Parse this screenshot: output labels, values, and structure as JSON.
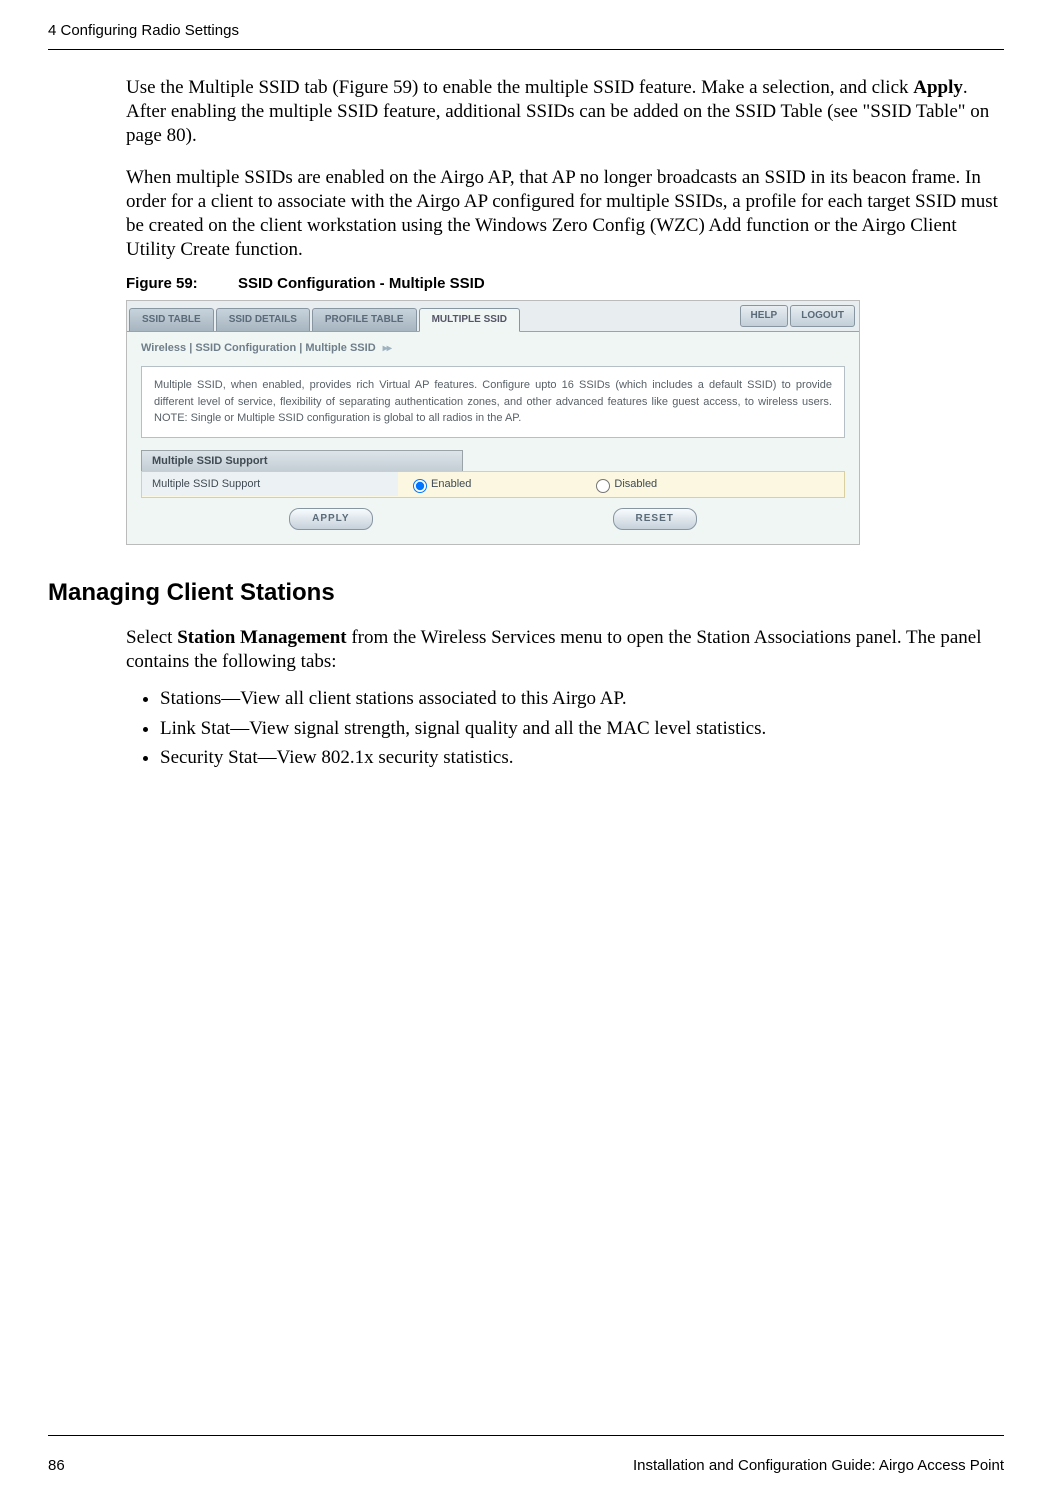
{
  "header": {
    "chapter": "4  Configuring Radio Settings"
  },
  "paragraphs": {
    "p1_a": "Use the Multiple SSID tab (Figure 59) to enable the multiple SSID feature. Make a selection, and click ",
    "p1_bold": "Apply",
    "p1_b": ". After enabling the multiple SSID feature, additional SSIDs can be added on the SSID Table (see \"SSID Table\" on page 80).",
    "p2": "When multiple SSIDs are enabled on the Airgo AP, that AP no longer broadcasts an SSID in its beacon frame. In order for a client to associate with the Airgo AP configured for multiple SSIDs, a profile for each target SSID must be created on the client workstation using the Windows Zero Config (WZC) Add function or the Airgo Client Utility Create function."
  },
  "figure": {
    "label": "Figure 59:",
    "title": "SSID Configuration - Multiple SSID"
  },
  "screenshot": {
    "tabs": [
      "SSID TABLE",
      "SSID DETAILS",
      "PROFILE TABLE",
      "MULTIPLE SSID"
    ],
    "active_tab_index": 3,
    "buttons": {
      "help": "HELP",
      "logout": "LOGOUT"
    },
    "breadcrumb": "Wireless | SSID Configuration | Multiple SSID",
    "info": "Multiple SSID, when enabled, provides rich Virtual AP features. Configure upto 16 SSIDs (which includes a default SSID) to provide different level of service, flexibility of separating authentication zones, and other advanced features like guest access, to wireless users. NOTE: Single or Multiple SSID configuration is global to all radios in the AP.",
    "section_title": "Multiple SSID Support",
    "row_label": "Multiple SSID Support",
    "enabled_label": "Enabled",
    "disabled_label": "Disabled",
    "selected": "enabled",
    "apply": "APPLY",
    "reset": "RESET"
  },
  "section2": {
    "heading": "Managing Client Stations",
    "intro_a": "Select ",
    "intro_bold": "Station Management",
    "intro_b": " from the Wireless Services menu to open the Station Associations panel. The panel contains the following tabs:",
    "bullets": [
      "Stations—View all client stations associated to this Airgo AP.",
      "Link Stat—View signal strength, signal quality and all the MAC level statistics.",
      "Security Stat—View 802.1x security statistics."
    ]
  },
  "footer": {
    "page": "86",
    "title": "Installation and Configuration Guide: Airgo Access Point"
  }
}
